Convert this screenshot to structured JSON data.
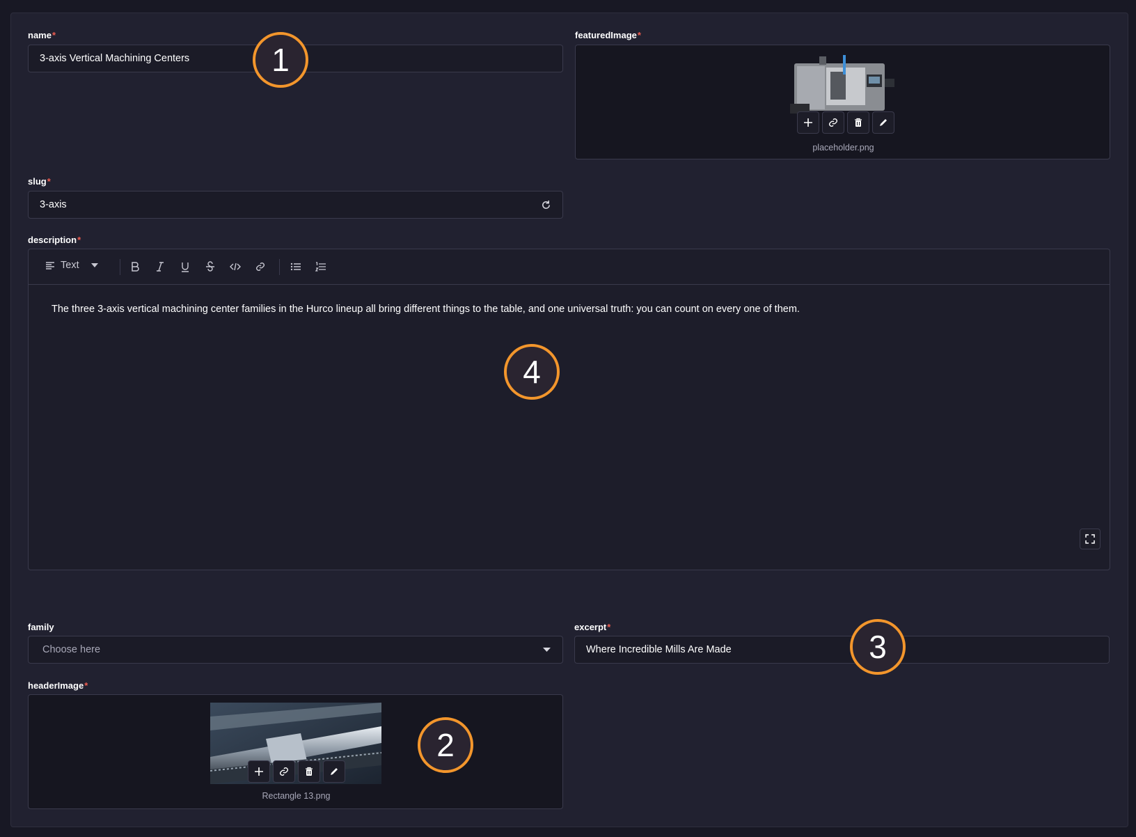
{
  "form": {
    "name": {
      "label": "name",
      "required": "*",
      "value": "3-axis Vertical Machining Centers"
    },
    "featuredImage": {
      "label": "featuredImage",
      "required": "*",
      "filename": "placeholder.png"
    },
    "slug": {
      "label": "slug",
      "required": "*",
      "value": "3-axis"
    },
    "description": {
      "label": "description",
      "required": "*",
      "toolbar": {
        "format_label": "Text"
      },
      "text": "The three 3-axis vertical machining center families in the Hurco lineup all bring different things to the table, and one universal truth: you can count on every one of them."
    },
    "family": {
      "label": "family",
      "placeholder": "Choose here"
    },
    "excerpt": {
      "label": "excerpt",
      "required": "*",
      "value": "Where Incredible Mills Are Made"
    },
    "headerImage": {
      "label": "headerImage",
      "required": "*",
      "filename": "Rectangle 13.png"
    }
  },
  "annotations": [
    "1",
    "2",
    "3",
    "4"
  ],
  "colors": {
    "accent_badge": "#f3962c",
    "required": "#ee5d50",
    "background": "#181824",
    "panel": "#212130"
  }
}
